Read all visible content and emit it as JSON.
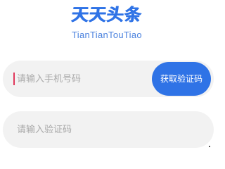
{
  "app": {
    "name": "天天头条",
    "subtitle": "TianTianTouTiao"
  },
  "login_form": {
    "phone_field": {
      "placeholder": "请输入手机号码",
      "value": ""
    },
    "get_code_button_label": "获取验证码",
    "code_field": {
      "placeholder": "请输入验证码",
      "value": ""
    }
  },
  "colors": {
    "brand": "#2f73e6",
    "field_background": "#f2f2f2",
    "placeholder": "#a9a9a9",
    "caret": "#e0375a"
  }
}
